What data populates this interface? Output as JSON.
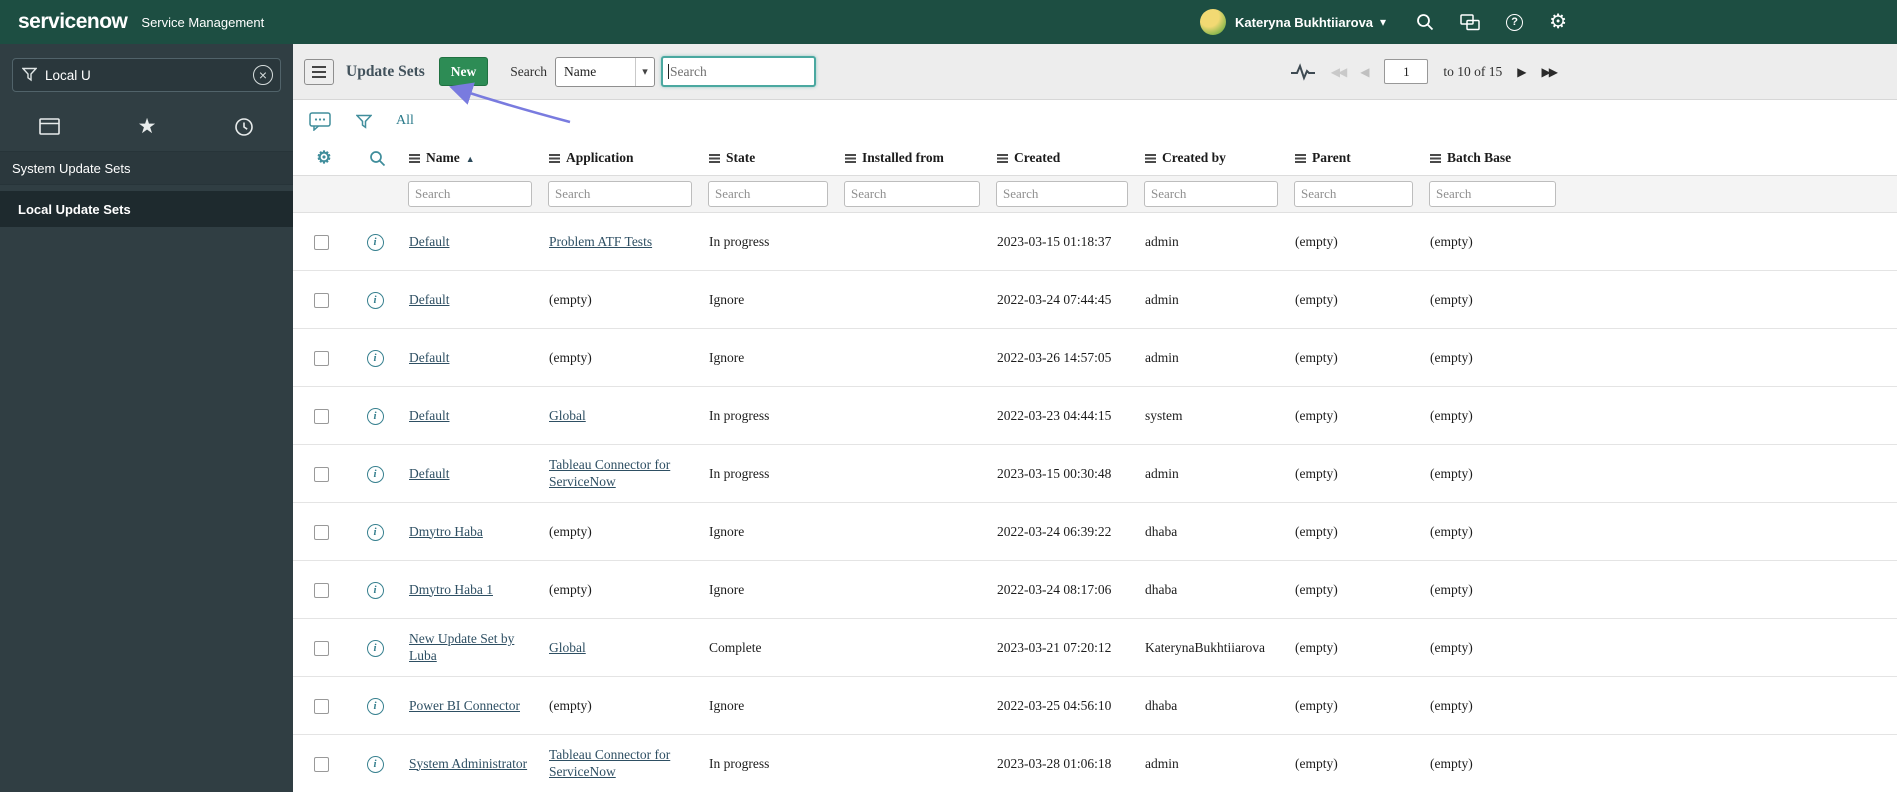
{
  "topbar": {
    "logo": "servicenow",
    "app_label": "Service Management",
    "user_name": "Kateryna Bukhtiiarova",
    "icons": [
      "search-icon",
      "connect-chat-icon",
      "help-icon",
      "settings-gear-icon"
    ]
  },
  "sidebar": {
    "filter_value": "Local U",
    "tabs": [
      "all-applications",
      "favorites",
      "history"
    ],
    "section_label": "System Update Sets",
    "selected_item": "Local Update Sets"
  },
  "toolbar": {
    "title": "Update Sets",
    "new_button": "New",
    "search_label": "Search",
    "search_column": "Name",
    "search_placeholder": "Search",
    "pager": {
      "page_value": "1",
      "range_text": "to 10 of 15"
    }
  },
  "breadcrumb": {
    "all": "All"
  },
  "list": {
    "columns": [
      "Name",
      "Application",
      "State",
      "Installed from",
      "Created",
      "Created by",
      "Parent",
      "Batch Base"
    ],
    "sorted_column": "Name",
    "sort_direction": "ascending",
    "filter_placeholder": "Search",
    "rows": [
      {
        "name": "Default",
        "application": "Problem ATF Tests",
        "application_link": true,
        "state": "In progress",
        "installed_from": "",
        "created": "2023-03-15 01:18:37",
        "created_by": "admin",
        "parent": "(empty)",
        "batch_base": "(empty)"
      },
      {
        "name": "Default",
        "application": "(empty)",
        "application_link": false,
        "state": "Ignore",
        "installed_from": "",
        "created": "2022-03-24 07:44:45",
        "created_by": "admin",
        "parent": "(empty)",
        "batch_base": "(empty)"
      },
      {
        "name": "Default",
        "application": "(empty)",
        "application_link": false,
        "state": "Ignore",
        "installed_from": "",
        "created": "2022-03-26 14:57:05",
        "created_by": "admin",
        "parent": "(empty)",
        "batch_base": "(empty)"
      },
      {
        "name": "Default",
        "application": "Global",
        "application_link": true,
        "state": "In progress",
        "installed_from": "",
        "created": "2022-03-23 04:44:15",
        "created_by": "system",
        "parent": "(empty)",
        "batch_base": "(empty)"
      },
      {
        "name": "Default",
        "application": "Tableau Connector for ServiceNow",
        "application_link": true,
        "state": "In progress",
        "installed_from": "",
        "created": "2023-03-15 00:30:48",
        "created_by": "admin",
        "parent": "(empty)",
        "batch_base": "(empty)"
      },
      {
        "name": "Dmytro Haba",
        "application": "(empty)",
        "application_link": false,
        "state": "Ignore",
        "installed_from": "",
        "created": "2022-03-24 06:39:22",
        "created_by": "dhaba",
        "parent": "(empty)",
        "batch_base": "(empty)"
      },
      {
        "name": "Dmytro Haba 1",
        "application": "(empty)",
        "application_link": false,
        "state": "Ignore",
        "installed_from": "",
        "created": "2022-03-24 08:17:06",
        "created_by": "dhaba",
        "parent": "(empty)",
        "batch_base": "(empty)"
      },
      {
        "name": "New Update Set by Luba",
        "application": "Global",
        "application_link": true,
        "state": "Complete",
        "installed_from": "",
        "created": "2023-03-21 07:20:12",
        "created_by": "KaterynaBukhtiiarova",
        "parent": "(empty)",
        "batch_base": "(empty)"
      },
      {
        "name": "Power BI Connector",
        "application": "(empty)",
        "application_link": false,
        "state": "Ignore",
        "installed_from": "",
        "created": "2022-03-25 04:56:10",
        "created_by": "dhaba",
        "parent": "(empty)",
        "batch_base": "(empty)"
      },
      {
        "name": "System Administrator",
        "application": "Tableau Connector for ServiceNow",
        "application_link": true,
        "state": "In progress",
        "installed_from": "",
        "created": "2023-03-28 01:06:18",
        "created_by": "admin",
        "parent": "(empty)",
        "batch_base": "(empty)"
      }
    ]
  },
  "colors": {
    "header_green": "#1d4e42",
    "sidebar_dark": "#303e43",
    "button_green": "#2d8c55",
    "accent_teal": "#3f8d9b",
    "link_color": "#2e4f63",
    "focus_border": "#4aa8a0",
    "annotation_purple": "#797bdf"
  }
}
